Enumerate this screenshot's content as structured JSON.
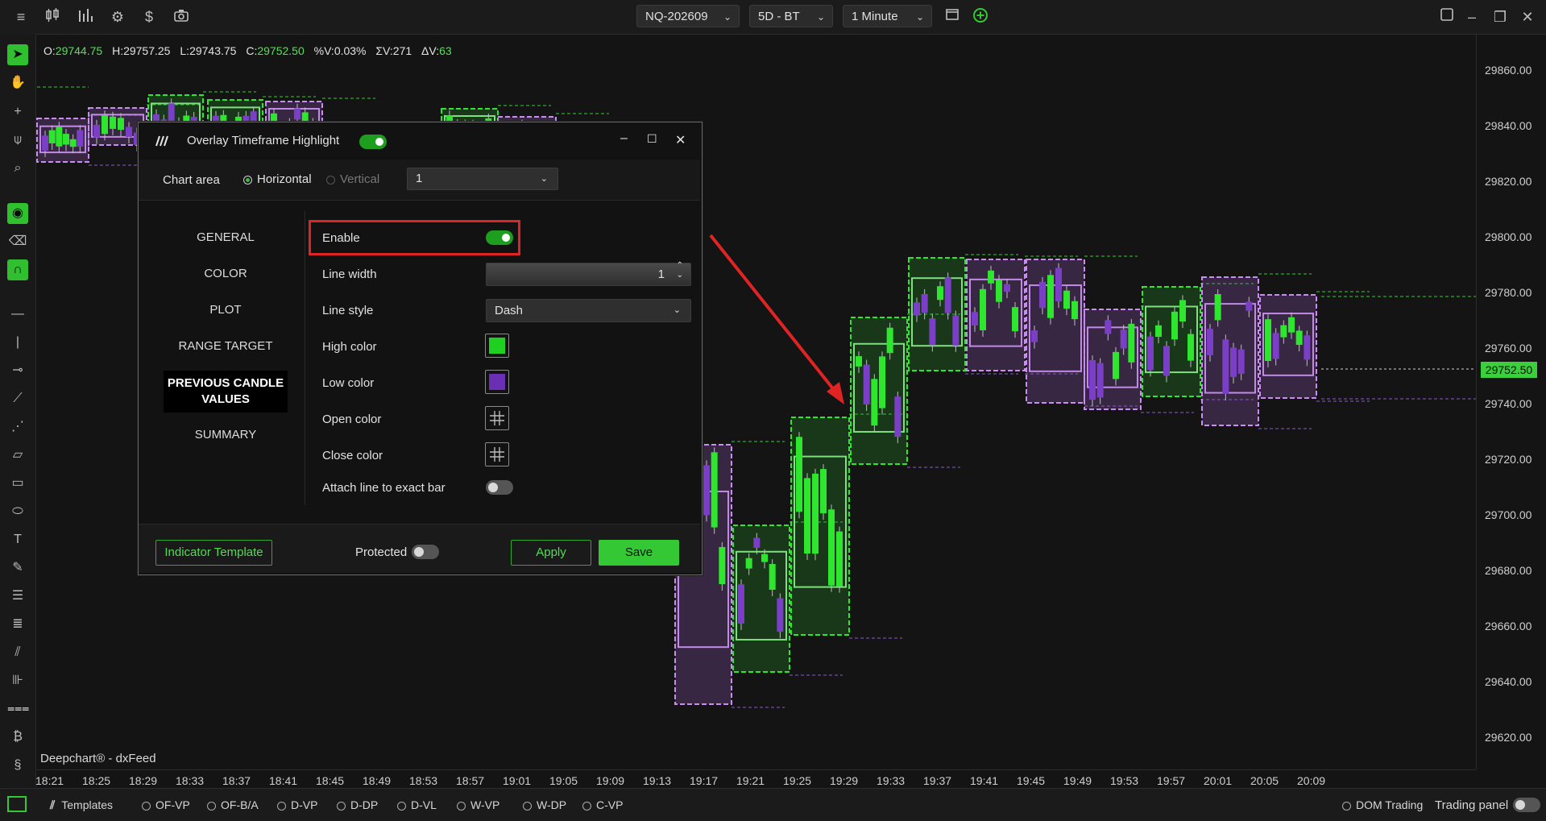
{
  "topbar": {
    "symbol": "NQ-202609",
    "period": "5D - BT",
    "timeframe": "1 Minute"
  },
  "ohlc": {
    "o_label": "O:",
    "o": "29744.75",
    "h_label": "H:",
    "h": "29757.25",
    "l_label": "L:",
    "l": "29743.75",
    "c_label": "C:",
    "c": "29752.50",
    "pv_label": "%V:",
    "pv": "0.03%",
    "sv_label": "ΣV:",
    "sv": "271",
    "dv_label": "ΔV:",
    "dv": "63"
  },
  "yaxis": [
    "29860.00",
    "29840.00",
    "29820.00",
    "29800.00",
    "29780.00",
    "29760.00",
    "29740.00",
    "29720.00",
    "29700.00",
    "29680.00",
    "29660.00",
    "29640.00",
    "29620.00"
  ],
  "current_price": "29752.50",
  "xaxis": [
    "18:21",
    "18:25",
    "18:29",
    "18:33",
    "18:37",
    "18:41",
    "18:45",
    "18:49",
    "18:53",
    "18:57",
    "19:01",
    "19:05",
    "19:09",
    "19:13",
    "19:17",
    "19:21",
    "19:25",
    "19:29",
    "19:33",
    "19:37",
    "19:41",
    "19:45",
    "19:49",
    "19:53",
    "19:57",
    "20:01",
    "20:05",
    "20:09"
  ],
  "watermark": "Deepchart® - dxFeed",
  "colors": {
    "bull": "#2ee62e",
    "bear": "#7a3fc6",
    "accent": "#35c835",
    "highlight_red": "#e02424"
  },
  "dialog": {
    "title": "Overlay Timeframe Highlight",
    "enabled": true,
    "chart_area_label": "Chart area",
    "horizontal_label": "Horizontal",
    "vertical_label": "Vertical",
    "chart_area_value": "1",
    "nav": [
      "GENERAL",
      "COLOR",
      "PLOT",
      "RANGE TARGET",
      "PREVIOUS CANDLE VALUES",
      "SUMMARY"
    ],
    "selected_nav": "PREVIOUS CANDLE VALUES",
    "enable_label": "Enable",
    "line_width_label": "Line width",
    "line_width_value": "1",
    "line_style_label": "Line style",
    "line_style_value": "Dash",
    "high_color_label": "High color",
    "high_color": "#20d020",
    "low_color_label": "Low color",
    "low_color": "#6a2fb5",
    "open_color_label": "Open color",
    "close_color_label": "Close color",
    "attach_label": "Attach line to exact bar",
    "indicator_template": "Indicator Template",
    "protected_label": "Protected",
    "apply": "Apply",
    "save": "Save"
  },
  "bottombar": {
    "templates": "Templates",
    "items": [
      "OF-VP",
      "OF-B/A",
      "D-VP",
      "D-DP",
      "D-VL",
      "W-VP",
      "W-DP",
      "C-VP"
    ],
    "dom_trading": "DOM Trading",
    "trading_panel": "Trading panel"
  },
  "icons": {
    "top": [
      "menu-icon",
      "candles-icon",
      "bars-icon",
      "gear-icon",
      "dollar-icon",
      "camera-icon",
      "window-icon",
      "add-circle-icon"
    ],
    "left": [
      "pointer-icon",
      "hand-icon",
      "crosshair-icon",
      "magnet-pointer-icon",
      "zoom-icon",
      "eye-icon",
      "eraser-icon",
      "magnet-icon",
      "hline-icon",
      "vline-icon",
      "ray-icon",
      "trendline-icon",
      "path-icon",
      "ruler-icon",
      "rectangle-icon",
      "ellipse-icon",
      "text-icon",
      "pencil-icon",
      "list-icon",
      "list-alt-icon",
      "fib-icon",
      "fib-alt-icon",
      "levels-icon",
      "dollar-bars-icon",
      "dollar-coins-icon"
    ]
  }
}
